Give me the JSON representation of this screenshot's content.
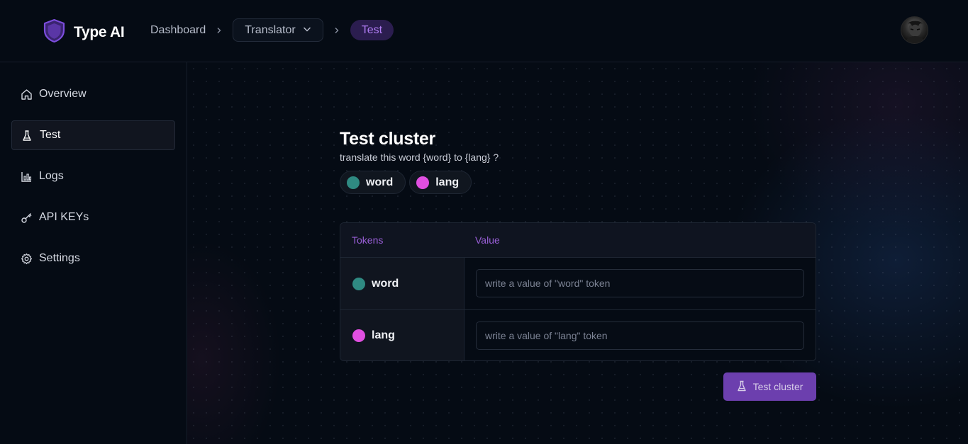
{
  "app": {
    "name": "Type AI"
  },
  "breadcrumb": {
    "dashboard": "Dashboard",
    "project": "Translator",
    "current": "Test"
  },
  "sidebar": {
    "items": [
      {
        "label": "Overview",
        "icon": "home-icon"
      },
      {
        "label": "Test",
        "icon": "flask-icon",
        "active": true
      },
      {
        "label": "Logs",
        "icon": "bar-chart-icon"
      },
      {
        "label": "API KEYs",
        "icon": "key-icon"
      },
      {
        "label": "Settings",
        "icon": "gear-icon"
      }
    ]
  },
  "main": {
    "title": "Test cluster",
    "prompt": "translate this word {word} to {lang} ?",
    "tokens": [
      {
        "name": "word",
        "color": "#2f8a82"
      },
      {
        "name": "lang",
        "color": "#e04fe0"
      }
    ],
    "table": {
      "headers": {
        "tokens": "Tokens",
        "value": "Value"
      },
      "rows": [
        {
          "token": "word",
          "color": "#2f8a82",
          "value": "",
          "placeholder": "write a value of \"word\" token"
        },
        {
          "token": "lang",
          "color": "#e04fe0",
          "value": "",
          "placeholder": "write a value of \"lang\" token"
        }
      ]
    },
    "action": {
      "label": "Test cluster",
      "icon": "flask-icon"
    }
  },
  "colors": {
    "background": "#050b14",
    "accent": "#6c3fae",
    "accent_text": "#9a5fd8",
    "word_token": "#2f8a82",
    "lang_token": "#e04fe0"
  }
}
